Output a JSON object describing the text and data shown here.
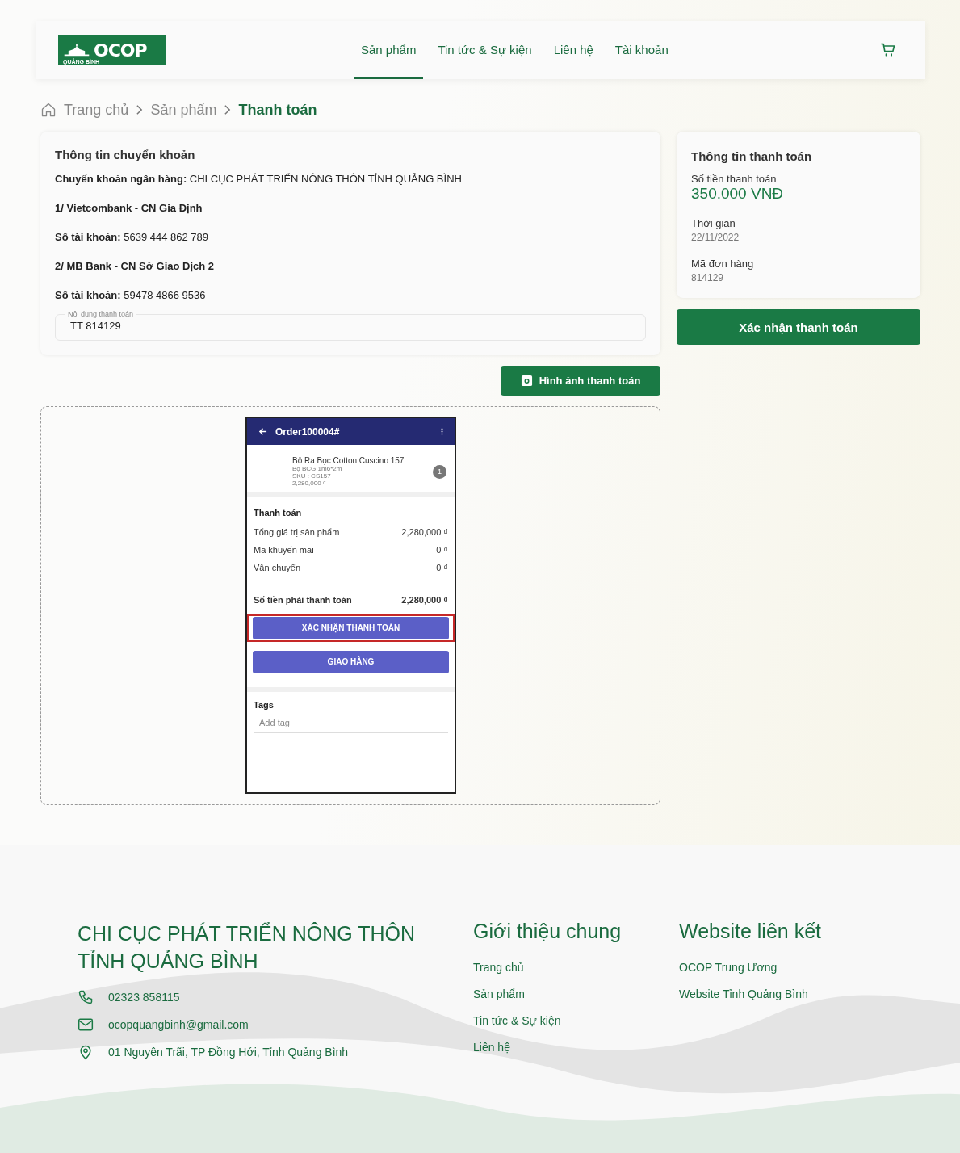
{
  "header": {
    "logo": {
      "text": "OCOP",
      "subtext": "QUẢNG BÌNH"
    },
    "nav": [
      {
        "label": "Sản phẩm",
        "selected": true
      },
      {
        "label": "Tin tức & Sự kiện",
        "selected": false
      },
      {
        "label": "Liên hệ",
        "selected": false
      },
      {
        "label": "Tài khoản",
        "selected": false
      }
    ]
  },
  "breadcrumb": [
    {
      "label": "Trang chủ",
      "current": false
    },
    {
      "label": "Sản phẩm",
      "current": false
    },
    {
      "label": "Thanh toán",
      "current": true
    }
  ],
  "transfer_info": {
    "title": "Thông tin chuyển khoản",
    "lines": [
      {
        "kind": "detail",
        "label": "Chuyển khoản ngân hàng:",
        "value": "CHI CỤC PHÁT TRIỂN NÔNG THÔN TỈNH QUẢNG BÌNH"
      },
      {
        "kind": "heading",
        "label": "1/ Vietcombank - CN Gia Định"
      },
      {
        "kind": "detail",
        "label": "Số tài khoản:",
        "value": "5639 444 862 789"
      },
      {
        "kind": "heading",
        "label": "2/ MB Bank - CN Sở Giao Dịch 2"
      },
      {
        "kind": "detail",
        "label": "Số tài khoản:",
        "value": "59478 4866 9536"
      }
    ],
    "field": {
      "label": "Nội dung thanh toán",
      "value": "TT 814129"
    }
  },
  "upload_button": "Hình ảnh thanh toán",
  "payment_screenshot": {
    "app_bar_title": "Order100004#",
    "product": {
      "name": "Bộ Ra Bọc Cotton Cuscino 157",
      "variant": "Bộ BCG 1m6*2m",
      "sku": "SKU : CS157",
      "price": "2,280,000 ₫",
      "quantity": "1"
    },
    "section_title": "Thanh toán",
    "rows": [
      {
        "label": "Tổng giá trị sản phẩm",
        "value": "2,280,000 ₫"
      },
      {
        "label": "Mã khuyến mãi",
        "value": "0 ₫"
      },
      {
        "label": "Vận chuyển",
        "value": "0 ₫"
      }
    ],
    "total": {
      "label": "Số tiền phải thanh toán",
      "value": "2,280,000 ₫"
    },
    "buttons": [
      {
        "label": "XÁC NHẬN THANH TOÁN",
        "highlighted": true
      },
      {
        "label": "GIAO HÀNG",
        "highlighted": false
      }
    ],
    "tags_title": "Tags",
    "tag_placeholder": "Add tag"
  },
  "payment_summary": {
    "title": "Thông tin thanh toán",
    "amount_label": "Số tiền thanh toán",
    "amount": "350.000 VNĐ",
    "items": [
      {
        "label": "Thời gian",
        "value": "22/11/2022"
      },
      {
        "label": "Mã đơn hàng",
        "value": "814129"
      }
    ],
    "confirm_button": "Xác nhận thanh toán"
  },
  "footer": {
    "org_name": "CHI CỤC PHÁT TRIỂN NÔNG THÔN TỈNH QUẢNG BÌNH",
    "contacts": [
      {
        "kind": "phone",
        "text": "02323 858115"
      },
      {
        "kind": "email",
        "text": "ocopquangbinh@gmail.com"
      },
      {
        "kind": "address",
        "text": "01 Nguyễn Trãi, TP Đồng Hới, Tỉnh Quảng Bình"
      }
    ],
    "columns": [
      {
        "title": "Giới thiệu chung",
        "links": [
          "Trang chủ",
          "Sản phẩm",
          "Tin tức & Sự kiện",
          "Liên hệ"
        ]
      },
      {
        "title": "Website liên kết",
        "links": [
          "OCOP Trung Ương",
          "Website Tỉnh Quảng Bình"
        ]
      }
    ]
  }
}
